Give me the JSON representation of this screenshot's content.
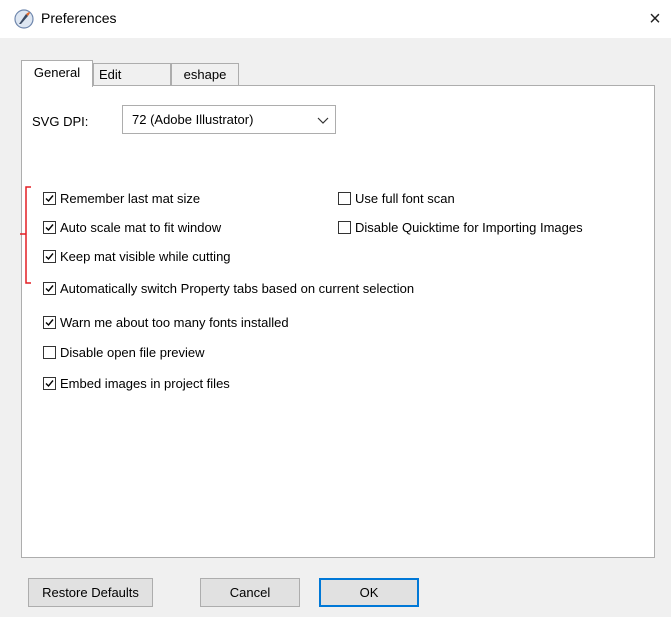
{
  "window": {
    "title": "Preferences",
    "close_glyph": "×",
    "icon": "cricut-knife-icon"
  },
  "tabs": [
    {
      "label": "General",
      "active": true
    },
    {
      "label": "Edit",
      "active": false
    },
    {
      "label": "eshape",
      "active": false
    }
  ],
  "general": {
    "svg_dpi_label": "SVG DPI:",
    "svg_dpi_value": "72 (Adobe Illustrator)",
    "options": {
      "remember_mat_size": {
        "label": "Remember last mat size",
        "checked": true
      },
      "auto_scale_mat": {
        "label": "Auto scale mat to fit window",
        "checked": true
      },
      "keep_mat_visible": {
        "label": "Keep mat visible while cutting",
        "checked": true
      },
      "auto_switch_tabs": {
        "label": "Automatically switch Property tabs based on current selection",
        "checked": true
      },
      "warn_fonts": {
        "label": "Warn me about too many fonts installed",
        "checked": true
      },
      "disable_preview": {
        "label": "Disable open file preview",
        "checked": false
      },
      "embed_images": {
        "label": "Embed images in project files",
        "checked": true
      },
      "full_font_scan": {
        "label": "Use full font scan",
        "checked": false
      },
      "disable_quicktime": {
        "label": "Disable Quicktime for Importing Images",
        "checked": false
      }
    }
  },
  "buttons": {
    "restore_defaults": "Restore Defaults",
    "cancel": "Cancel",
    "ok": "OK"
  },
  "colors": {
    "annotation_bracket": "#e31e24",
    "default_button_border": "#0078d7"
  }
}
